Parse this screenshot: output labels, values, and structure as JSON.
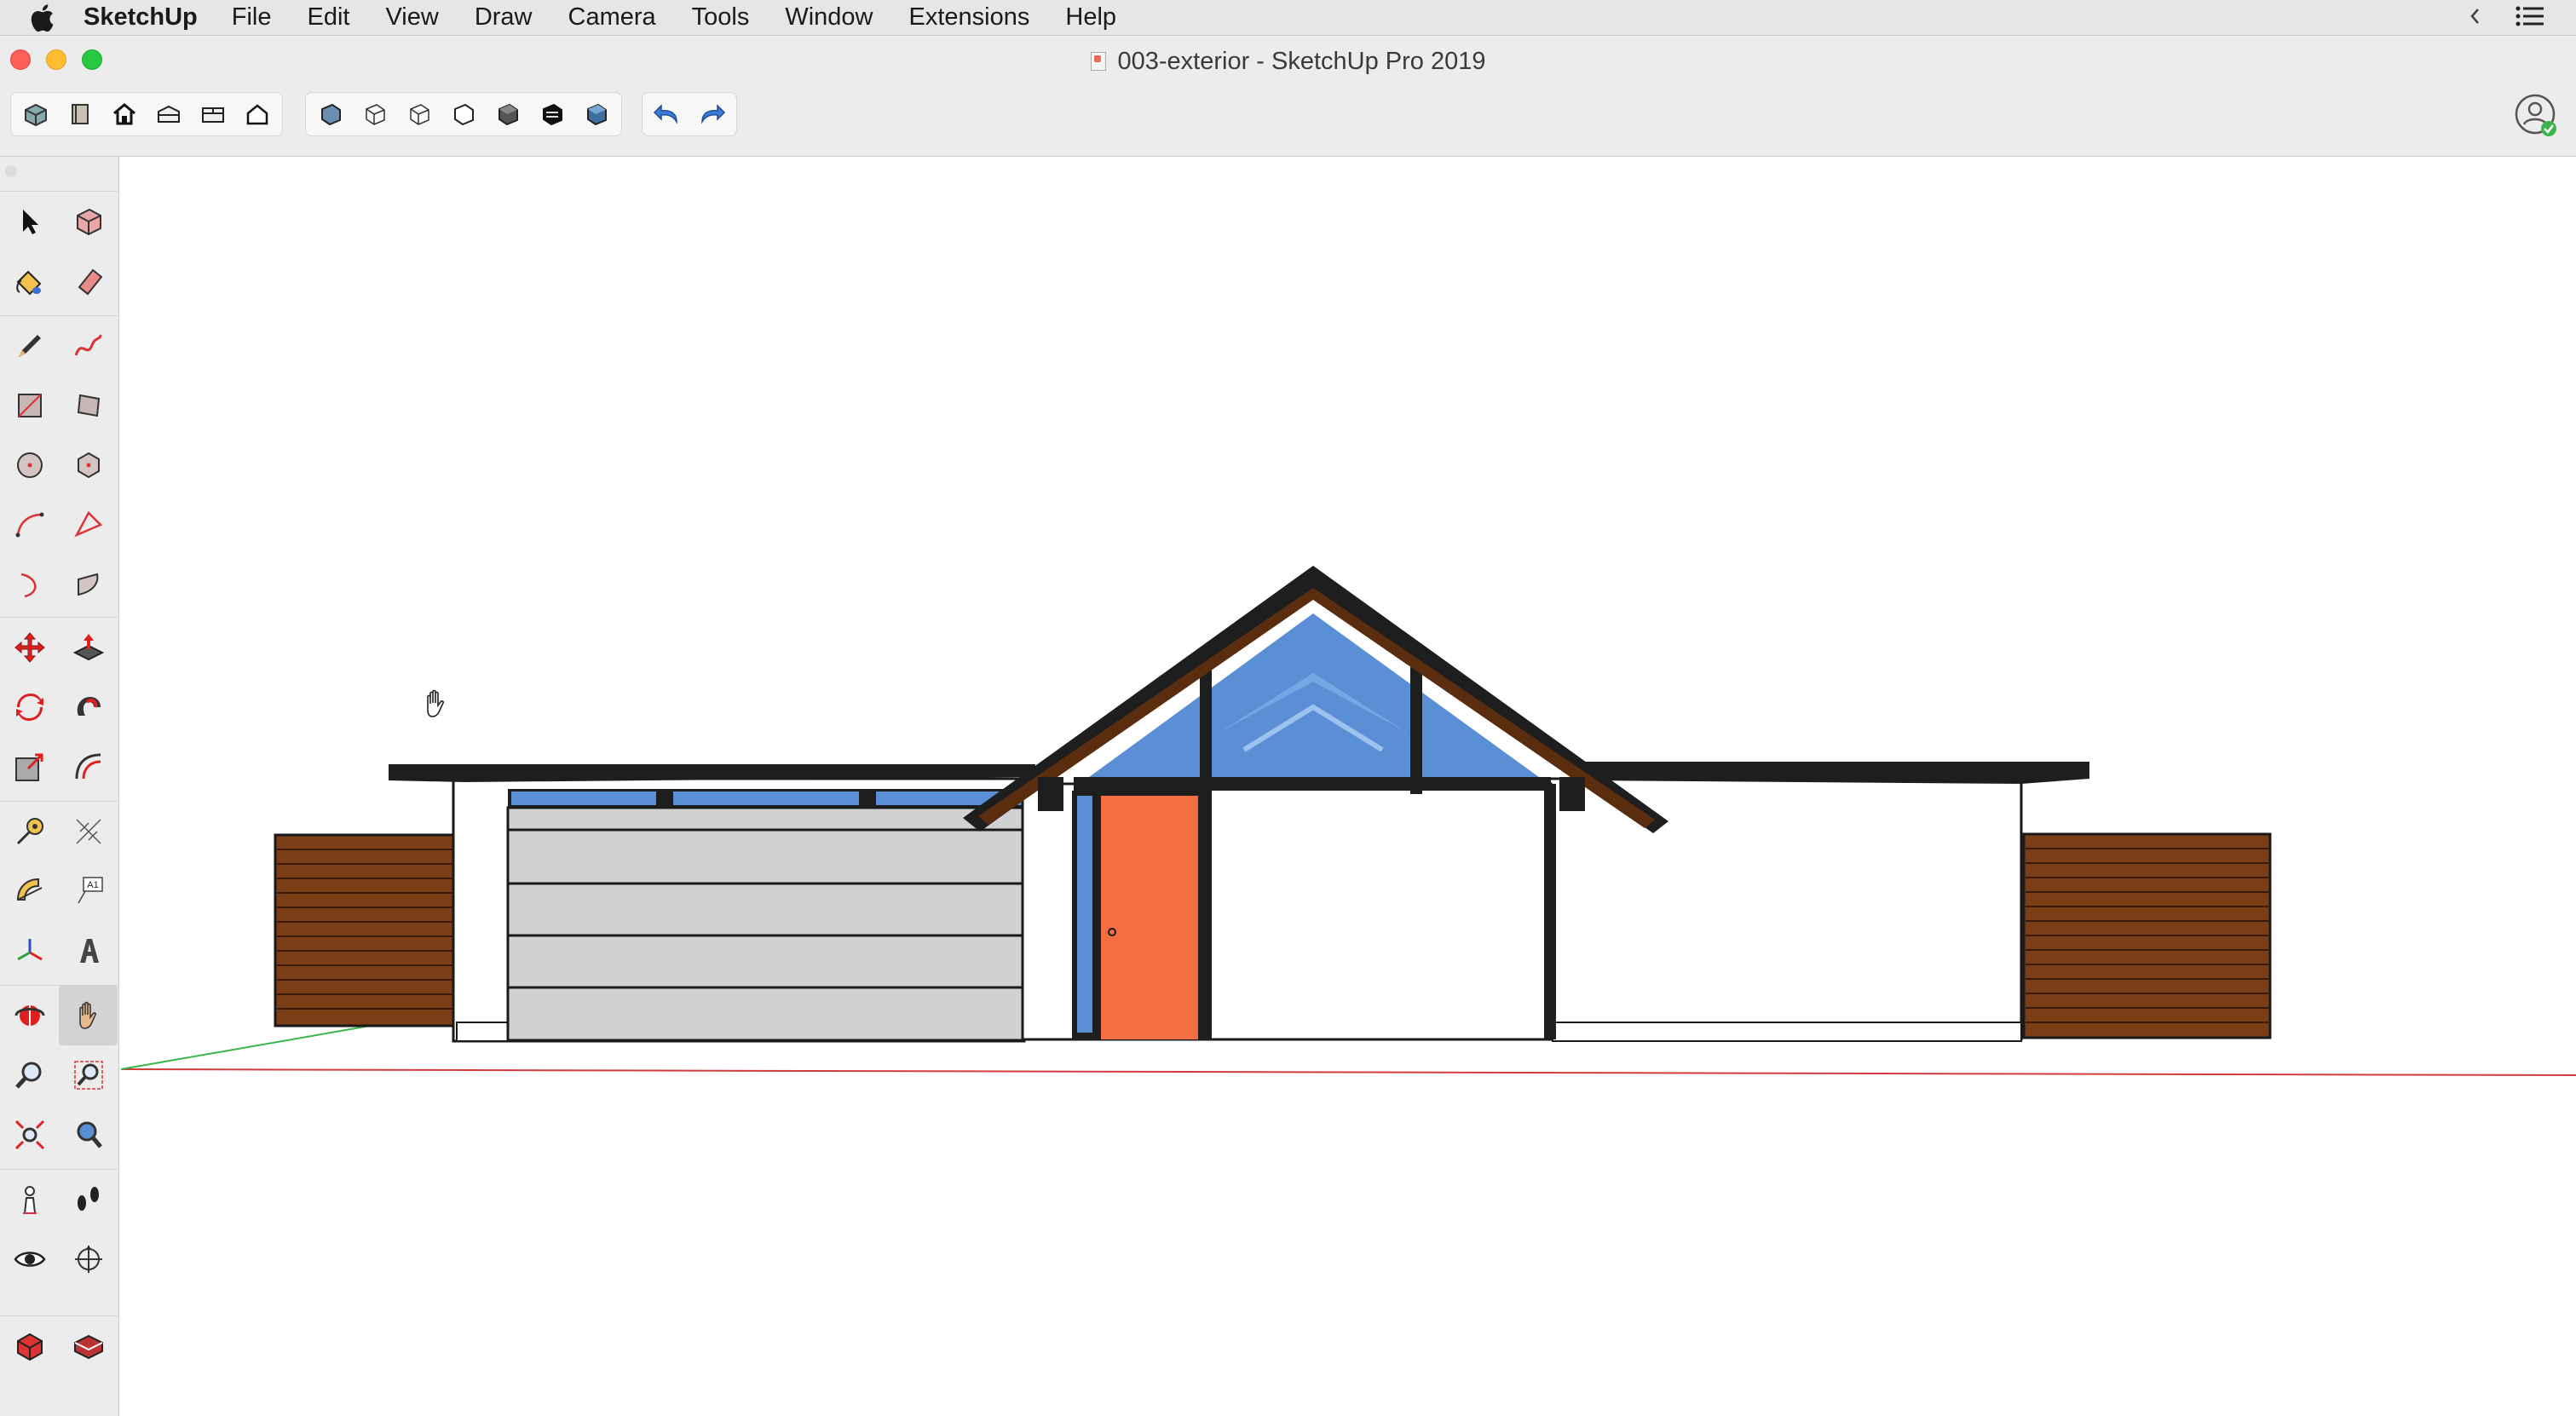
{
  "menubar": {
    "app_name": "SketchUp",
    "items": [
      "File",
      "Edit",
      "View",
      "Draw",
      "Camera",
      "Tools",
      "Window",
      "Extensions",
      "Help"
    ]
  },
  "window": {
    "title": "003-exterior - SketchUp Pro 2019"
  },
  "toolbar": {
    "groups": [
      [
        "components-icon",
        "materials-icon",
        "warehouse-icon",
        "iso-view-icon",
        "top-view-icon",
        "front-view-icon"
      ],
      [
        "xray-style-icon",
        "wireframe-style-icon",
        "hidden-line-style-icon",
        "hidden-line-2-icon",
        "shaded-style-icon",
        "shaded-textures-icon",
        "monochrome-style-icon"
      ],
      [
        "undo-icon",
        "redo-icon"
      ]
    ]
  },
  "palette": {
    "groups": [
      [
        [
          "select-tool-icon",
          "make-component-icon"
        ],
        [
          "paint-bucket-icon",
          "eraser-icon"
        ]
      ],
      [
        [
          "pencil-line-icon",
          "freehand-icon"
        ],
        [
          "rectangle-icon",
          "rotated-rectangle-icon"
        ],
        [
          "circle-icon",
          "polygon-icon"
        ],
        [
          "arc-icon",
          "two-point-arc-icon"
        ],
        [
          "three-point-arc-icon",
          "pie-icon"
        ]
      ],
      [
        [
          "move-icon",
          "push-pull-icon"
        ],
        [
          "rotate-icon",
          "follow-me-icon"
        ],
        [
          "scale-icon",
          "offset-icon"
        ]
      ],
      [
        [
          "tape-measure-icon",
          "dimension-icon"
        ],
        [
          "protractor-icon",
          "text-icon"
        ],
        [
          "axes-icon",
          "3d-text-icon"
        ]
      ],
      [
        [
          "orbit-icon",
          "pan-icon"
        ],
        [
          "zoom-icon",
          "zoom-window-icon"
        ],
        [
          "zoom-extents-icon",
          "previous-view-icon"
        ]
      ],
      [
        [
          "position-camera-icon",
          "walk-icon"
        ],
        [
          "look-around-icon",
          "section-plane-icon"
        ]
      ],
      [
        [
          "warehouse-3d-icon",
          "extension-warehouse-icon"
        ]
      ]
    ],
    "active_tool": "pan-icon"
  },
  "colors": {
    "door": "#f36f43",
    "glass": "#5a8fd6",
    "wood": "#7a3f17",
    "roof": "#1e1e1e",
    "panel": "#d1d1d1",
    "red_axis": "#d33b3b",
    "green_axis": "#39b54a"
  }
}
